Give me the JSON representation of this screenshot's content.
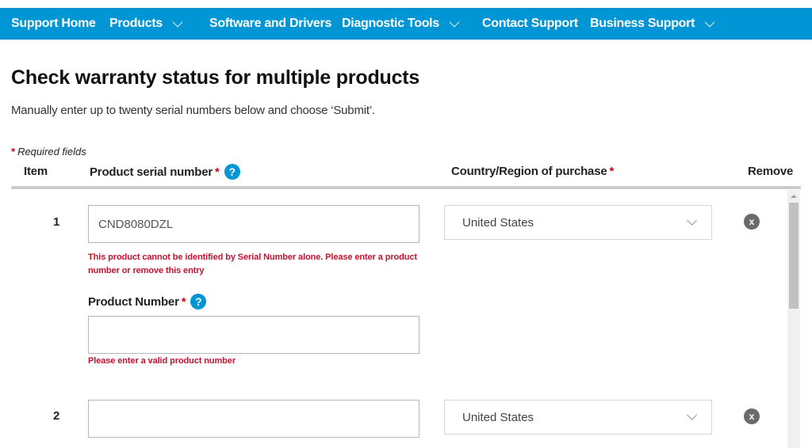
{
  "nav": {
    "items": [
      {
        "label": "Support Home",
        "has_dropdown": false
      },
      {
        "label": "Products",
        "has_dropdown": true
      },
      {
        "label": "Software and Drivers",
        "has_dropdown": false
      },
      {
        "label": "Diagnostic Tools",
        "has_dropdown": true
      },
      {
        "label": "Contact Support",
        "has_dropdown": false
      },
      {
        "label": "Business Support",
        "has_dropdown": true
      }
    ],
    "color": "#0096d6"
  },
  "page": {
    "title": "Check warranty status for multiple products",
    "subtitle": "Manually enter up to twenty serial numbers below and choose ‘Submit’.",
    "required_star": "*",
    "required_note": "Required fields"
  },
  "table": {
    "headers": {
      "item": "Item",
      "serial": "Product serial number",
      "country": "Country/Region of purchase",
      "remove": "Remove"
    },
    "help_icon_glyph": "?",
    "remove_icon_glyph": "x",
    "rows": [
      {
        "item": "1",
        "serial_value": "CND8080DZL",
        "serial_error": "This product cannot be identified by Serial Number alone. Please enter a product number or remove this entry",
        "product_number_label": "Product Number",
        "product_number_value": "",
        "product_number_error": "Please enter a valid product number",
        "country": "United States"
      },
      {
        "item": "2",
        "serial_value": "",
        "country": "United States"
      }
    ]
  },
  "colors": {
    "accent": "#0096d6",
    "error": "#c8102e",
    "required_star": "#d0021b"
  }
}
